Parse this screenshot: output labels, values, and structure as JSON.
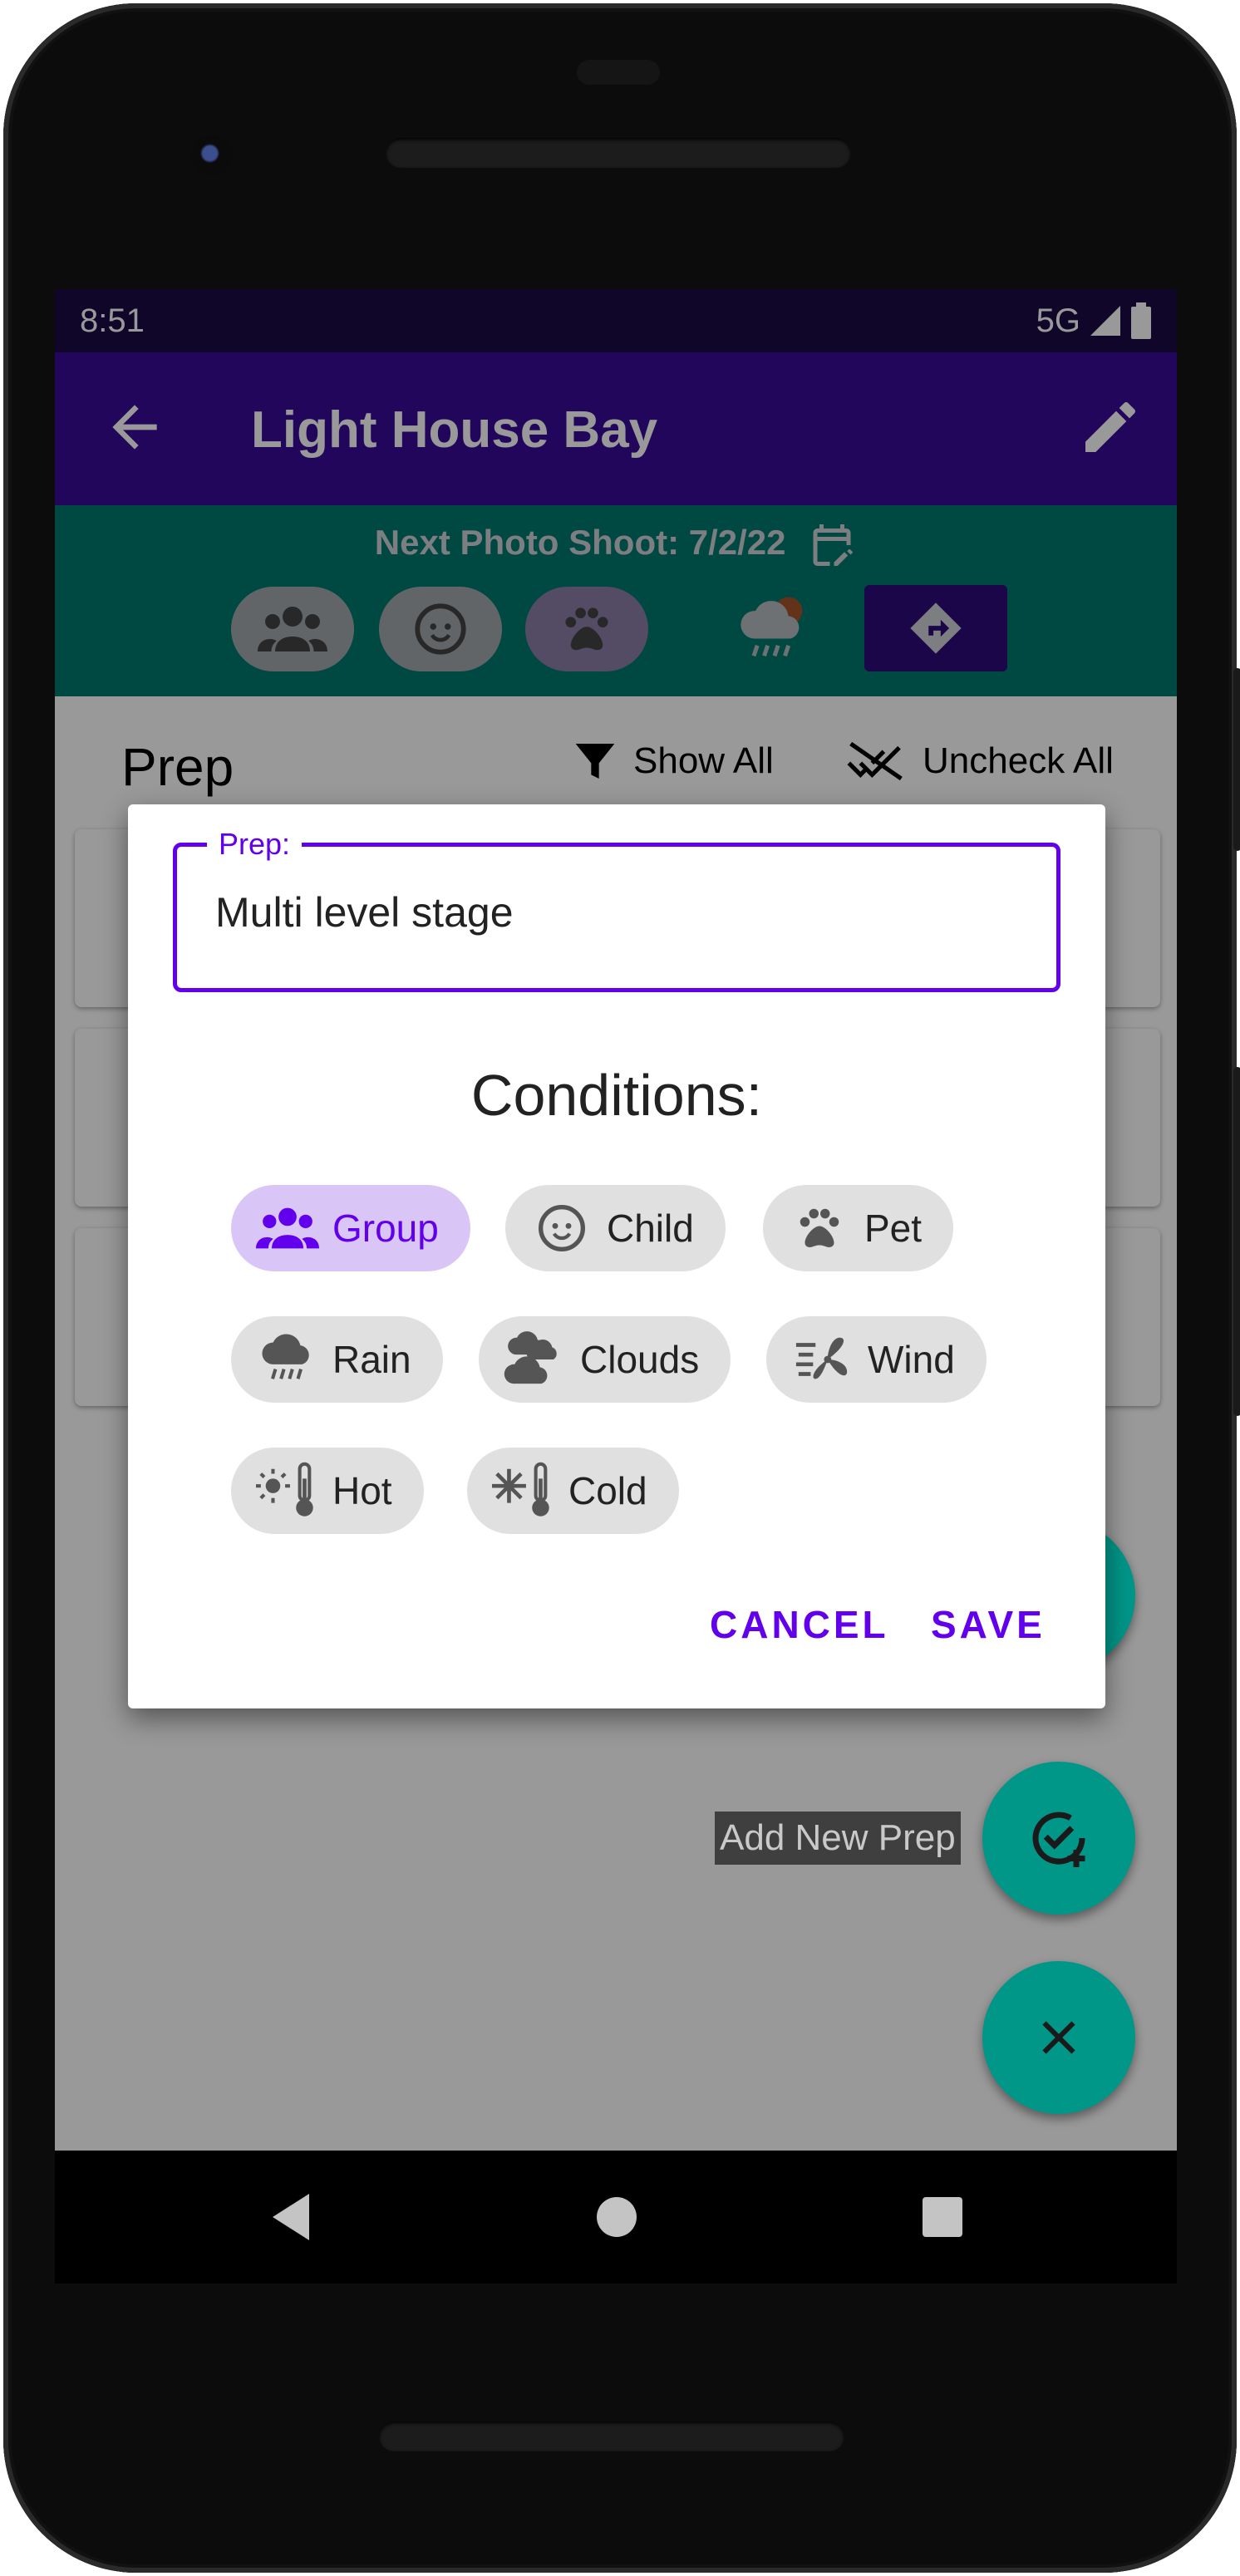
{
  "status_bar": {
    "time": "8:51",
    "network": "5G"
  },
  "app_bar": {
    "title": "Light House Bay",
    "back_icon": "arrow-left-icon",
    "edit_icon": "pencil-icon"
  },
  "photo_shoot": {
    "label": "Next Photo Shoot: 7/2/22",
    "icon": "calendar-edit-icon"
  },
  "filter_conditions": [
    {
      "icon": "group-icon",
      "active": false
    },
    {
      "icon": "child-face-icon",
      "active": false
    },
    {
      "icon": "paw-icon",
      "active": true
    }
  ],
  "prep_section": {
    "heading": "Prep",
    "show_all": "Show All",
    "uncheck_all": "Uncheck All"
  },
  "dialog": {
    "field_label": "Prep:",
    "field_value": "Multi level stage",
    "conditions_title": "Conditions:",
    "chips": [
      {
        "label": "Group",
        "icon": "group-icon",
        "selected": true
      },
      {
        "label": "Child",
        "icon": "child-face-icon",
        "selected": false
      },
      {
        "label": "Pet",
        "icon": "paw-icon",
        "selected": false
      },
      {
        "label": "Rain",
        "icon": "rain-icon",
        "selected": false
      },
      {
        "label": "Clouds",
        "icon": "clouds-icon",
        "selected": false
      },
      {
        "label": "Wind",
        "icon": "wind-icon",
        "selected": false
      },
      {
        "label": "Hot",
        "icon": "thermometer-hot-icon",
        "selected": false
      },
      {
        "label": "Cold",
        "icon": "thermometer-cold-icon",
        "selected": false
      }
    ],
    "cancel_label": "CANCEL",
    "save_label": "SAVE"
  },
  "fab": {
    "add_label": "Add New Prep"
  },
  "colors": {
    "primary": "#6200ee",
    "app_bar": "#3a0a99",
    "teal": "#007a6e",
    "fab": "#009688"
  }
}
